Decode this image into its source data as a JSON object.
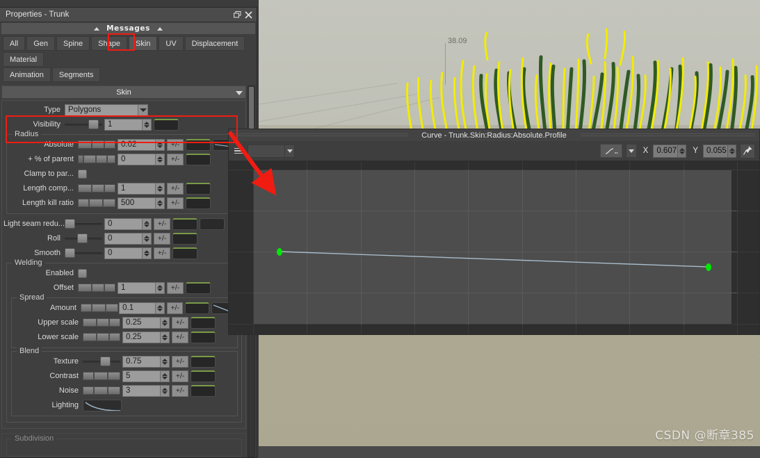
{
  "window": {
    "title": "Properties - Trunk",
    "restore_icon": "restore-icon",
    "close_icon": "close-icon"
  },
  "messages_bar": {
    "label": "Messages"
  },
  "tabs_row1": [
    {
      "label": "All",
      "selected": false
    },
    {
      "label": "Gen",
      "selected": false
    },
    {
      "label": "Spine",
      "selected": false
    },
    {
      "label": "Shape",
      "selected": false
    },
    {
      "label": "Skin",
      "selected": true
    },
    {
      "label": "UV",
      "selected": false
    },
    {
      "label": "Displacement",
      "selected": false
    },
    {
      "label": "Material",
      "selected": false
    }
  ],
  "tabs_row2": [
    {
      "label": "Animation",
      "selected": false
    },
    {
      "label": "Segments",
      "selected": false
    }
  ],
  "skin_group": {
    "header": "Skin"
  },
  "properties": {
    "type": {
      "label": "Type",
      "value": "Polygons"
    },
    "visibility": {
      "label": "Visibility",
      "value": "1"
    },
    "radius_legend": "Radius",
    "absolute": {
      "label": "Absolute",
      "value": "0.02",
      "pm": "+/-"
    },
    "pct_of_parent": {
      "label": "+ % of parent",
      "value": "0",
      "pm": "+/-"
    },
    "clamp_to_parent": {
      "label": "Clamp to par...",
      "checked": false
    },
    "length_comp": {
      "label": "Length comp...",
      "value": "1",
      "pm": "+/-"
    },
    "length_kill_ratio": {
      "label": "Length kill ratio",
      "value": "500",
      "pm": "+/-"
    },
    "light_seam_reduction": {
      "label": "Light seam redu...",
      "value": "0",
      "pm": "+/-"
    },
    "roll": {
      "label": "Roll",
      "value": "0",
      "pm": "+/-"
    },
    "smooth": {
      "label": "Smooth",
      "value": "0",
      "pm": "+/-"
    },
    "welding_legend": "Welding",
    "welding_enabled": {
      "label": "Enabled",
      "checked": false
    },
    "welding_offset": {
      "label": "Offset",
      "value": "1",
      "pm": "+/-"
    },
    "spread_legend": "Spread",
    "spread_amount": {
      "label": "Amount",
      "value": "0.1",
      "pm": "+/-"
    },
    "spread_upper": {
      "label": "Upper scale",
      "value": "0.25",
      "pm": "+/-"
    },
    "spread_lower": {
      "label": "Lower scale",
      "value": "0.25",
      "pm": "+/-"
    },
    "blend_legend": "Blend",
    "blend_texture": {
      "label": "Texture",
      "value": "0.75",
      "pm": "+/-"
    },
    "blend_contrast": {
      "label": "Contrast",
      "value": "5",
      "pm": "+/-"
    },
    "blend_noise": {
      "label": "Noise",
      "value": "3",
      "pm": "+/-"
    },
    "blend_lighting": {
      "label": "Lighting"
    },
    "subdivision_legend": "Subdivision"
  },
  "curve_editor": {
    "title": "Curve - Trunk.Skin:Radius:Absolute.Profile",
    "menu_icon": "hamburger-menu-icon",
    "preset_combo": {
      "value": ""
    },
    "interpolation_icon": "curve-interpolation-icon",
    "x": {
      "label": "X",
      "value": "0.607"
    },
    "y": {
      "label": "Y",
      "value": "0.055"
    },
    "pin_icon": "pin-icon"
  },
  "chart_data": {
    "type": "line",
    "title": "Curve - Trunk.Skin:Radius:Absolute.Profile",
    "xlabel": "",
    "ylabel": "",
    "xlim": [
      0,
      1
    ],
    "ylim": [
      0,
      1
    ],
    "grid": true,
    "legend": "none",
    "series": [
      {
        "name": "Profile",
        "x": [
          0.0,
          1.0
        ],
        "y": [
          0.138,
          0.055
        ],
        "control_points": [
          {
            "x": 0.0,
            "y": 0.138,
            "selected": true
          },
          {
            "x": 1.0,
            "y": 0.055,
            "selected": true
          }
        ]
      }
    ]
  },
  "viewport": {
    "measure_label": "38.09",
    "watermark": "CSDN @断章385"
  },
  "annotations": {
    "highlight_color": "#f01c12",
    "boxes": [
      {
        "name": "skin-tab-highlight"
      },
      {
        "name": "radius-section-highlight"
      }
    ],
    "arrow": {
      "name": "radius-to-curve-arrow"
    }
  }
}
